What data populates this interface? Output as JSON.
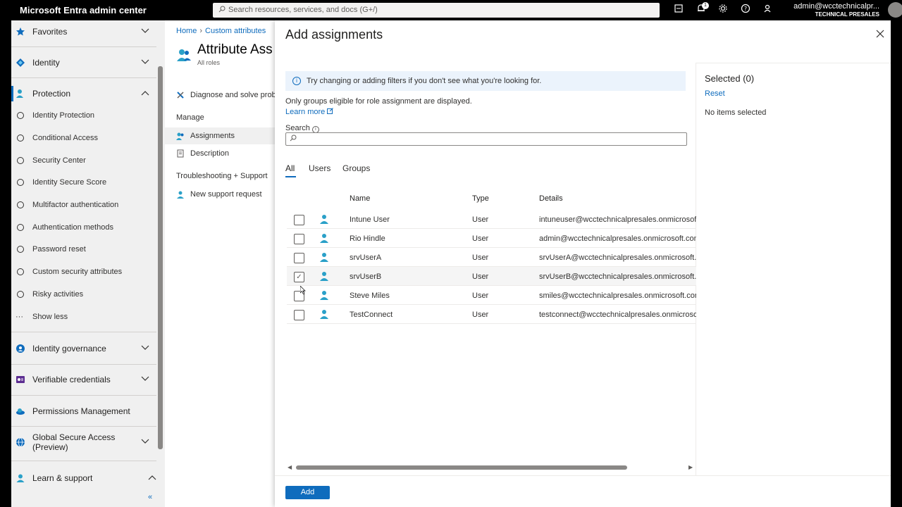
{
  "topbar": {
    "brand": "Microsoft Entra admin center",
    "search_placeholder": "Search resources, services, and docs (G+/)",
    "notification_count": "1",
    "account_user": "admin@wcctechnicalpr...",
    "account_org": "TECHNICAL PRESALES"
  },
  "nav": {
    "favorites": "Favorites",
    "identity": "Identity",
    "protection": "Protection",
    "protection_items": [
      "Identity Protection",
      "Conditional Access",
      "Security Center",
      "Identity Secure Score",
      "Multifactor authentication",
      "Authentication methods",
      "Password reset",
      "Custom security attributes",
      "Risky activities",
      "Show less"
    ],
    "identity_governance": "Identity governance",
    "verifiable_credentials": "Verifiable credentials",
    "permissions_management": "Permissions Management",
    "global_secure_access_1": "Global Secure Access",
    "global_secure_access_2": "(Preview)",
    "learn_support": "Learn & support",
    "collapse_glyph": "«"
  },
  "blade": {
    "breadcrumb_home": "Home",
    "breadcrumb_custom": "Custom attributes",
    "title": "Attribute Ass",
    "subtitle": "All roles",
    "diagnose": "Diagnose and solve proble",
    "manage_heading": "Manage",
    "assignments": "Assignments",
    "description": "Description",
    "troubleshooting_heading": "Troubleshooting + Support",
    "new_support": "New support request"
  },
  "panel": {
    "title": "Add assignments",
    "info": "Try changing or adding filters if you don't see what you're looking for.",
    "note": "Only groups eligible for role assignment are displayed.",
    "learn_more": "Learn more",
    "search_label": "Search",
    "tabs": [
      "All",
      "Users",
      "Groups"
    ],
    "columns": {
      "name": "Name",
      "type": "Type",
      "details": "Details"
    },
    "rows": [
      {
        "name": "Intune User",
        "type": "User",
        "details": "intuneuser@wcctechnicalpresales.onmicrosoft.com"
      },
      {
        "name": "Rio Hindle",
        "type": "User",
        "details": "admin@wcctechnicalpresales.onmicrosoft.com"
      },
      {
        "name": "srvUserA",
        "type": "User",
        "details": "srvUserA@wcctechnicalpresales.onmicrosoft.com"
      },
      {
        "name": "srvUserB",
        "type": "User",
        "details": "srvUserB@wcctechnicalpresales.onmicrosoft.com"
      },
      {
        "name": "Steve Miles",
        "type": "User",
        "details": "smiles@wcctechnicalpresales.onmicrosoft.com"
      },
      {
        "name": "TestConnect",
        "type": "User",
        "details": "testconnect@wcctechnicalpresales.onmicrosoft.com"
      }
    ],
    "add_button": "Add",
    "selected_title": "Selected (0)",
    "reset": "Reset",
    "no_items": "No items selected"
  },
  "colors": {
    "accent": "#0f6cbd",
    "user_icon": "#2aa0c8"
  }
}
